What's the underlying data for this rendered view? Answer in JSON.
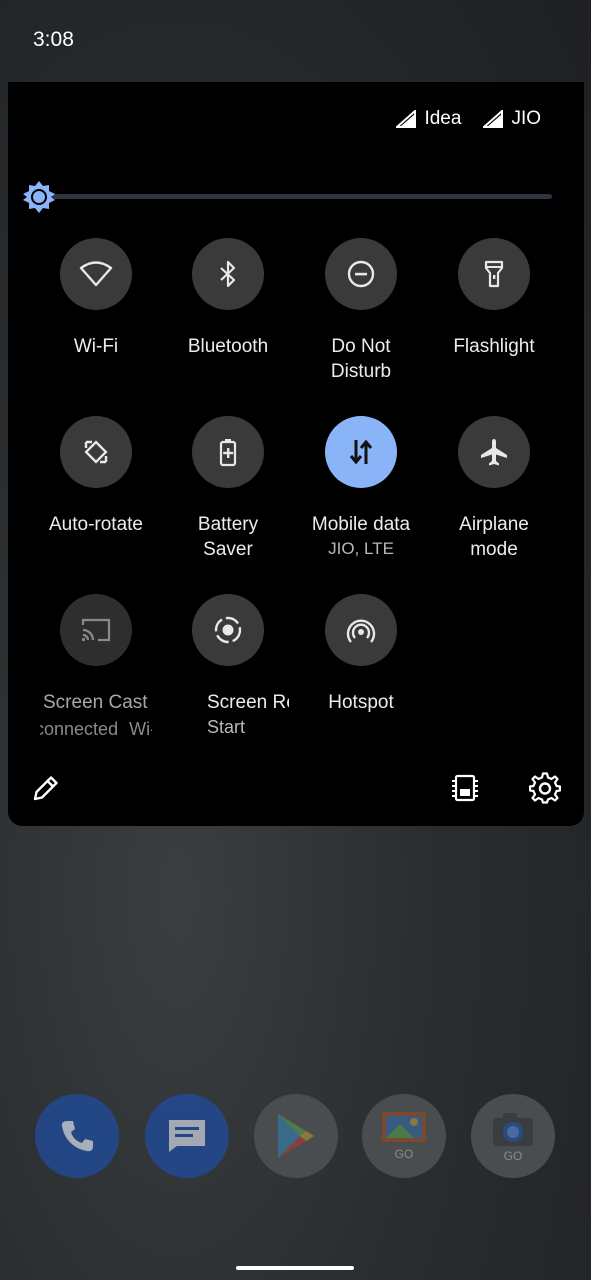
{
  "status_bar": {
    "time": "3:08"
  },
  "carriers": [
    {
      "name": "Idea"
    },
    {
      "name": "JIO"
    }
  ],
  "brightness": {
    "level": 0.0
  },
  "tiles": [
    {
      "label": "Wi-Fi",
      "icon": "wifi-icon",
      "active": false
    },
    {
      "label": "Bluetooth",
      "icon": "bluetooth-icon",
      "active": false
    },
    {
      "label": "Do Not Disturb",
      "icon": "do-not-disturb-icon",
      "active": false
    },
    {
      "label": "Flashlight",
      "icon": "flashlight-icon",
      "active": false
    },
    {
      "label": "Auto-rotate",
      "icon": "auto-rotate-icon",
      "active": false
    },
    {
      "label": "Battery Saver",
      "icon": "battery-saver-icon",
      "active": false
    },
    {
      "label": "Mobile data",
      "sub": "JIO, LTE",
      "icon": "mobile-data-icon",
      "active": true
    },
    {
      "label": "Airplane mode",
      "icon": "airplane-icon",
      "active": false
    },
    {
      "label": "Screen Cast",
      "sub": "Not connected Wi-Fi",
      "icon": "cast-icon",
      "active": false,
      "disabled": true
    },
    {
      "label": "Screen Record",
      "sub": "Start",
      "icon": "screen-record-icon",
      "active": false
    },
    {
      "label": "Hotspot",
      "icon": "hotspot-icon",
      "active": false
    }
  ],
  "footer": {
    "edit_icon": "edit-pencil-icon",
    "device_icon": "device-controls-icon",
    "settings_icon": "settings-gear-icon"
  },
  "dock": [
    {
      "name": "Phone",
      "icon": "phone-icon",
      "color": "#2a62c9"
    },
    {
      "name": "Messages",
      "icon": "messages-icon",
      "color": "#2a62c9"
    },
    {
      "name": "Play Store",
      "icon": "play-store-icon",
      "color": "#e6e6e6"
    },
    {
      "name": "Gallery Go",
      "icon": "gallery-go-icon",
      "badge": "GO",
      "color": "#e6e6e6"
    },
    {
      "name": "Camera Go",
      "icon": "camera-go-icon",
      "badge": "GO",
      "color": "#e6e6e6"
    }
  ],
  "colors": {
    "accent": "#8ab4f8",
    "tile": "#3a3a3a",
    "panel": "#000000"
  }
}
